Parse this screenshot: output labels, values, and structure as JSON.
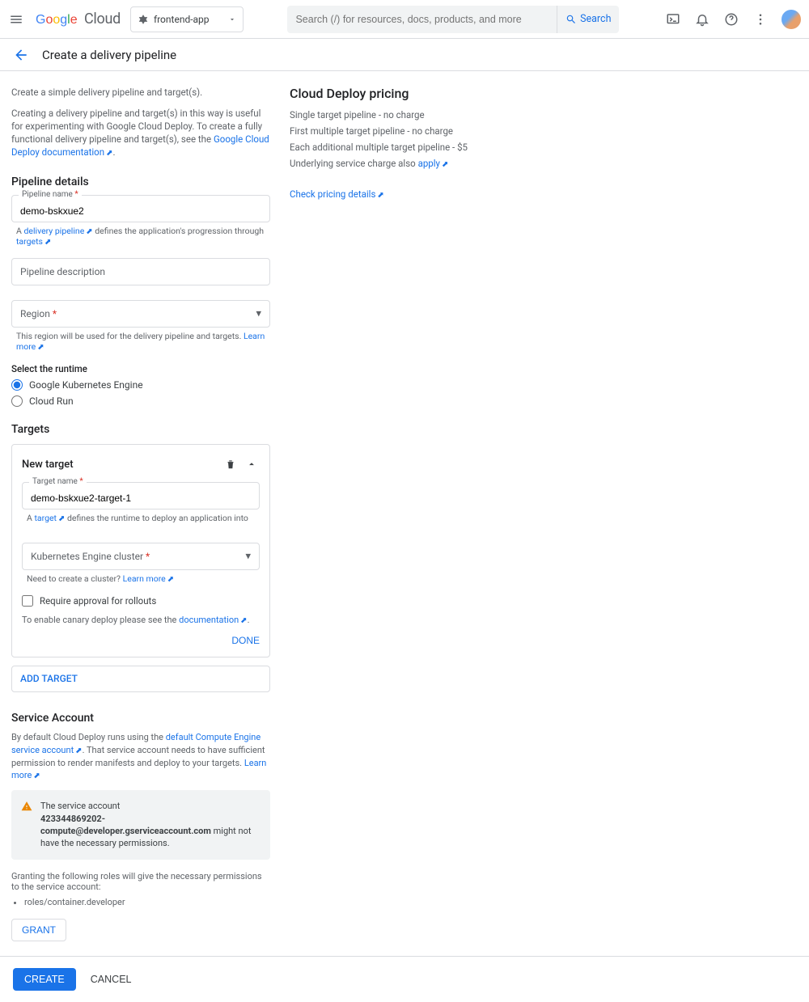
{
  "header": {
    "logo_cloud": "Cloud",
    "project": "frontend-app",
    "search_placeholder": "Search (/) for resources, docs, products, and more",
    "search_btn": "Search"
  },
  "subheader": {
    "title": "Create a delivery pipeline"
  },
  "intro1": "Create a simple delivery pipeline and target(s).",
  "intro2_a": "Creating a delivery pipeline and target(s) in this way is useful for experimenting with Google Cloud Deploy. To create a fully functional delivery pipeline and target(s), see the ",
  "intro2_link": "Google Cloud Deploy documentation",
  "pipeline_details": {
    "heading": "Pipeline details",
    "name_label": "Pipeline name",
    "name_value": "demo-bskxue2",
    "name_helper_a": "A ",
    "name_helper_link": "delivery pipeline",
    "name_helper_b": " defines the application's progression through ",
    "name_helper_link2": "targets",
    "desc_placeholder": "Pipeline description",
    "region_label": "Region",
    "region_helper": "This region will be used for the delivery pipeline and targets. ",
    "region_learn": "Learn more"
  },
  "runtime": {
    "heading": "Select the runtime",
    "opt1": "Google Kubernetes Engine",
    "opt2": "Cloud Run"
  },
  "targets": {
    "heading": "Targets",
    "card_title": "New target",
    "tname_label": "Target name",
    "tname_value": "demo-bskxue2-target-1",
    "tname_helper_a": "A ",
    "tname_helper_link": "target",
    "tname_helper_b": " defines the runtime to deploy an application into",
    "cluster_label": "Kubernetes Engine cluster",
    "cluster_helper": "Need to create a cluster? ",
    "cluster_learn": "Learn more",
    "approval": "Require approval for rollouts",
    "canary_a": "To enable canary deploy please see the ",
    "canary_link": "documentation",
    "done": "DONE",
    "add_target": "ADD TARGET"
  },
  "service_account": {
    "heading": "Service Account",
    "desc_a": "By default Cloud Deploy runs using the ",
    "desc_link": "default Compute Engine service account",
    "desc_b": ". That service account needs to have sufficient permission to render manifests and deploy to your targets. ",
    "desc_learn": "Learn more",
    "warn_a": "The service account",
    "warn_email": "423344869202-compute@developer.gserviceaccount.com",
    "warn_b": " might not have the necessary permissions.",
    "grant_desc": "Granting the following roles will give the necessary permissions to the service account:",
    "role": "roles/container.developer",
    "grant_btn": "GRANT"
  },
  "pricing": {
    "heading": "Cloud Deploy pricing",
    "l1": "Single target pipeline - no charge",
    "l2": "First multiple target pipeline - no charge",
    "l3": "Each additional multiple target pipeline - $5",
    "l4_a": "Underlying service charge also ",
    "l4_link": "apply",
    "check": "Check pricing details"
  },
  "footer": {
    "create": "CREATE",
    "cancel": "CANCEL"
  }
}
